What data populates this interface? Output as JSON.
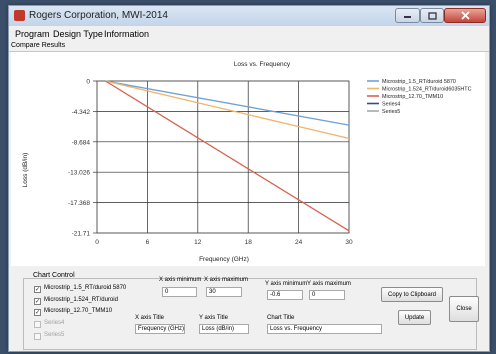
{
  "window": {
    "title": "Rogers Corporation, MWI-2014"
  },
  "menu": [
    "Program",
    "Design Type",
    "Information"
  ],
  "tab_label": "Compare Results",
  "chart_data": {
    "type": "line",
    "title": "Loss vs. Frequency",
    "xlabel": "Frequency (GHz)",
    "ylabel": "Loss (dB/in)",
    "xlim": [
      0,
      30
    ],
    "ylim": [
      -21.71,
      0
    ],
    "x_ticks": [
      "0",
      "6",
      "12",
      "18",
      "24",
      "30"
    ],
    "y_ticks": [
      "0",
      "-4.342",
      "-8.684",
      "-13.026",
      "-17.368",
      "-21.71"
    ],
    "x_tick_values": [
      0,
      6,
      12,
      18,
      24,
      30
    ],
    "y_tick_values": [
      0,
      -4.342,
      -8.684,
      -13.026,
      -17.368,
      -21.71
    ],
    "legend_position": "right",
    "series": [
      {
        "name": "Microstrip_1.5_RT/duroid 5870",
        "color": "#6fa1d6",
        "x": [
          1,
          30
        ],
        "y": [
          0,
          -6.3
        ]
      },
      {
        "name": "Microstrip_1.524_RT/duroid6035HTC",
        "color": "#f2b36a",
        "x": [
          1,
          30
        ],
        "y": [
          0,
          -8.2
        ]
      },
      {
        "name": "Microstrip_12.70_TMM10",
        "color": "#d5634e",
        "x": [
          1,
          30
        ],
        "y": [
          0,
          -21.4
        ]
      },
      {
        "name": "Series4",
        "color": "#2f4f8a",
        "x": [],
        "y": []
      },
      {
        "name": "Series5",
        "color": "#a9a9a9",
        "x": [],
        "y": []
      }
    ]
  },
  "controls": {
    "group_label": "Chart Control",
    "series_checks": [
      {
        "label": "Microstrip_1.5_RT/duroid 5870",
        "checked": true,
        "mark": "✓",
        "enabled": true
      },
      {
        "label": "Microstrip_1.524_RT/duroid",
        "checked": true,
        "mark": "✓",
        "enabled": true
      },
      {
        "label": "Microstrip_12.70_TMM10",
        "checked": true,
        "mark": "✓",
        "enabled": true
      },
      {
        "label": "Series4",
        "checked": false,
        "mark": "",
        "enabled": false
      },
      {
        "label": "Series5",
        "checked": false,
        "mark": "",
        "enabled": false
      }
    ],
    "x_min_label": "X axis minimum",
    "x_min_value": "0",
    "x_max_label": "X axis maximum",
    "x_max_value": "30",
    "y_min_label": "Y axis minimum",
    "y_min_value": "-0.6",
    "y_max_label": "Y axis maximum",
    "y_max_value": "0",
    "x_title_label": "X axis Title",
    "x_title_value": "Frequency (GHz)",
    "y_title_label": "Y axis Title",
    "y_title_value": "Loss (dB/in)",
    "chart_title_label": "Chart Title",
    "chart_title_value": "Loss vs. Frequency",
    "copy_button": "Copy to Clipboard",
    "update_button": "Update",
    "close_button": "Close"
  }
}
